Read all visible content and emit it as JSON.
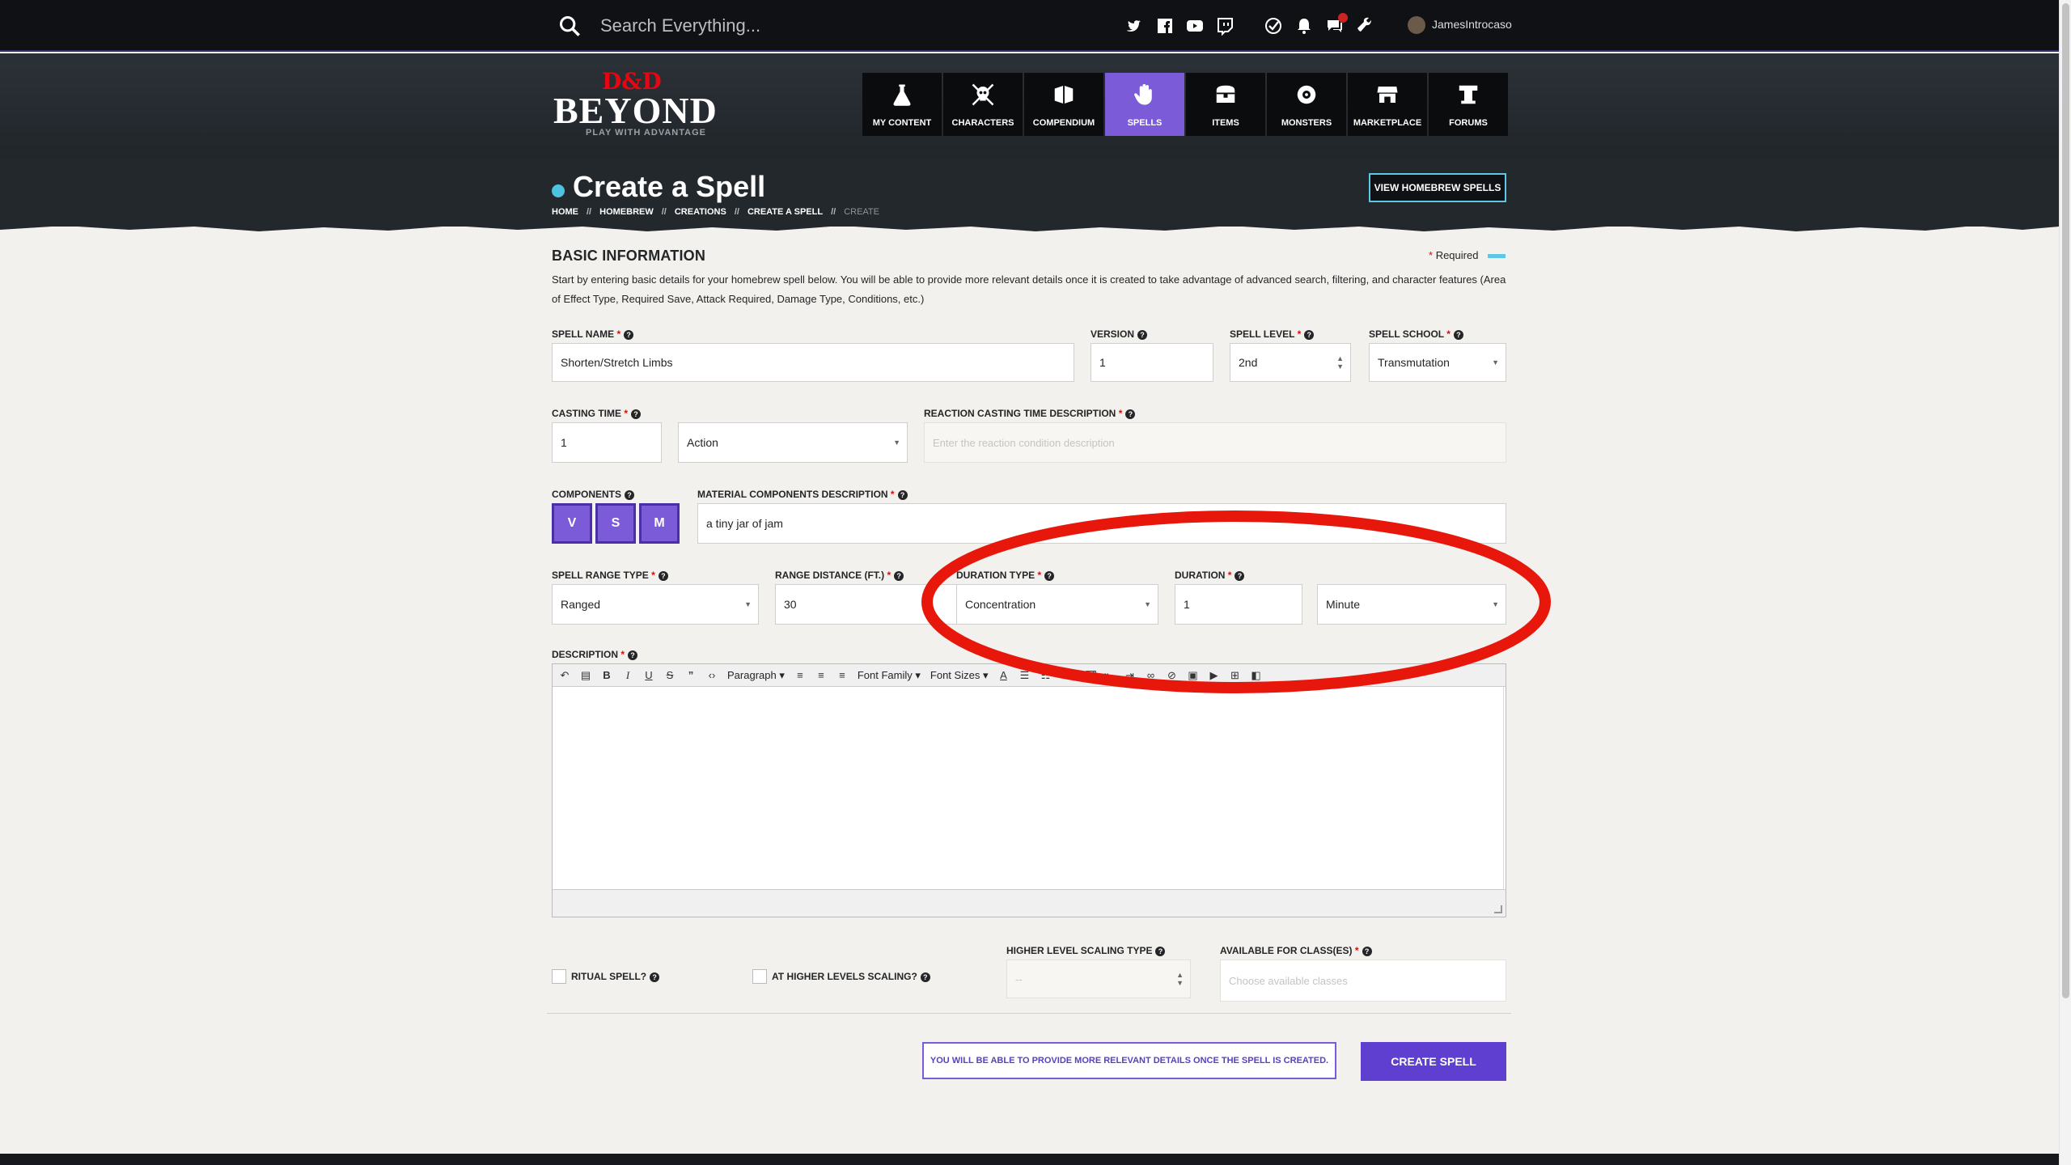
{
  "topbar": {
    "search_placeholder": "Search Everything...",
    "username": "JamesIntrocaso",
    "social_icons": [
      "twitter-icon",
      "facebook-icon",
      "youtube-icon",
      "twitch-icon"
    ],
    "utility_icons": [
      "clipboard-check-icon",
      "bell-icon",
      "chat-icon",
      "wrench-icon"
    ]
  },
  "logo": {
    "brand_top": "D&D",
    "brand_main": "BEYOND",
    "tagline": "PLAY WITH ADVANTAGE"
  },
  "nav": {
    "items": [
      {
        "label": "MY CONTENT",
        "icon": "flask-icon"
      },
      {
        "label": "CHARACTERS",
        "icon": "skull-crossbones-icon"
      },
      {
        "label": "COMPENDIUM",
        "icon": "book-icon"
      },
      {
        "label": "SPELLS",
        "icon": "hand-spell-icon"
      },
      {
        "label": "ITEMS",
        "icon": "chest-icon"
      },
      {
        "label": "MONSTERS",
        "icon": "monster-eye-icon"
      },
      {
        "label": "MARKETPLACE",
        "icon": "store-icon"
      },
      {
        "label": "FORUMS",
        "icon": "podium-icon"
      }
    ],
    "active_index": 3
  },
  "header": {
    "title": "Create a Spell",
    "breadcrumb": [
      "HOME",
      "HOMEBREW",
      "CREATIONS",
      "CREATE A SPELL",
      "CREATE"
    ],
    "separator": "//",
    "view_homebrew_label": "VIEW HOMEBREW SPELLS"
  },
  "form": {
    "section_title": "BASIC INFORMATION",
    "required_label": "Required",
    "required_marker": "*",
    "intro": "Start by entering basic details for your homebrew spell below. You will be able to provide more relevant details once it is created to take advantage of advanced search, filtering, and character features (Area of Effect Type, Required Save, Attack Required, Damage Type, Conditions, etc.)",
    "spell_name": {
      "label": "SPELL NAME",
      "value": "Shorten/Stretch Limbs"
    },
    "version": {
      "label": "VERSION",
      "value": "1"
    },
    "spell_level": {
      "label": "SPELL LEVEL",
      "value": "2nd"
    },
    "spell_school": {
      "label": "SPELL SCHOOL",
      "value": "Transmutation"
    },
    "casting_time": {
      "label": "CASTING TIME",
      "value": "1",
      "unit": "Action"
    },
    "reaction_desc": {
      "label": "REACTION CASTING TIME DESCRIPTION",
      "placeholder": "Enter the reaction condition description"
    },
    "components": {
      "label": "COMPONENTS",
      "buttons": [
        "V",
        "S",
        "M"
      ]
    },
    "material_desc": {
      "label": "MATERIAL COMPONENTS DESCRIPTION",
      "value": "a tiny jar of jam"
    },
    "range_type": {
      "label": "SPELL RANGE TYPE",
      "value": "Ranged"
    },
    "range_distance": {
      "label": "RANGE DISTANCE (FT.)",
      "value": "30"
    },
    "duration_type": {
      "label": "DURATION TYPE",
      "value": "Concentration"
    },
    "duration": {
      "label": "DURATION",
      "value": "1",
      "unit": "Minute"
    },
    "description": {
      "label": "DESCRIPTION",
      "format": "Paragraph",
      "font_family": "Font Family",
      "font_sizes": "Font Sizes"
    },
    "ritual": {
      "label": "RITUAL SPELL?"
    },
    "higher_levels": {
      "label": "AT HIGHER LEVELS SCALING?"
    },
    "scaling_type": {
      "label": "HIGHER LEVEL SCALING TYPE",
      "value": "--"
    },
    "classes": {
      "label": "AVAILABLE FOR CLASS(ES)",
      "placeholder": "Choose available classes"
    },
    "info_text": "YOU WILL BE ABLE TO PROVIDE MORE RELEVANT DETAILS ONCE THE SPELL IS CREATED.",
    "create_label": "CREATE SPELL"
  },
  "colors": {
    "accent_purple": "#7c5bd8",
    "accent_cyan": "#5cc8e6",
    "required_red": "#d01010",
    "annotation_red": "#e8170c"
  }
}
